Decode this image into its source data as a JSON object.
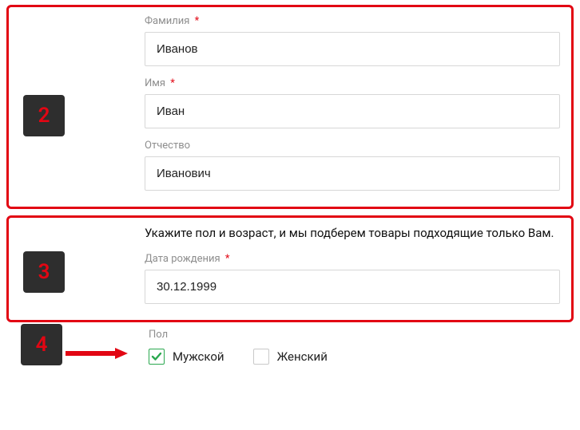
{
  "steps": {
    "s2": "2",
    "s3": "3",
    "s4": "4"
  },
  "name_block": {
    "lastname_label": "Фамилия",
    "lastname_value": "Иванов",
    "firstname_label": "Имя",
    "firstname_value": "Иван",
    "patronymic_label": "Отчество",
    "patronymic_value": "Иванович",
    "required_mark": "*"
  },
  "dob_block": {
    "instruction": "Укажите пол и возраст, и мы подберем товары подходящие только Вам.",
    "dob_label": "Дата рождения",
    "dob_value": "30.12.1999",
    "required_mark": "*"
  },
  "gender_block": {
    "label": "Пол",
    "male": "Мужской",
    "female": "Женский",
    "male_checked": true,
    "female_checked": false
  }
}
